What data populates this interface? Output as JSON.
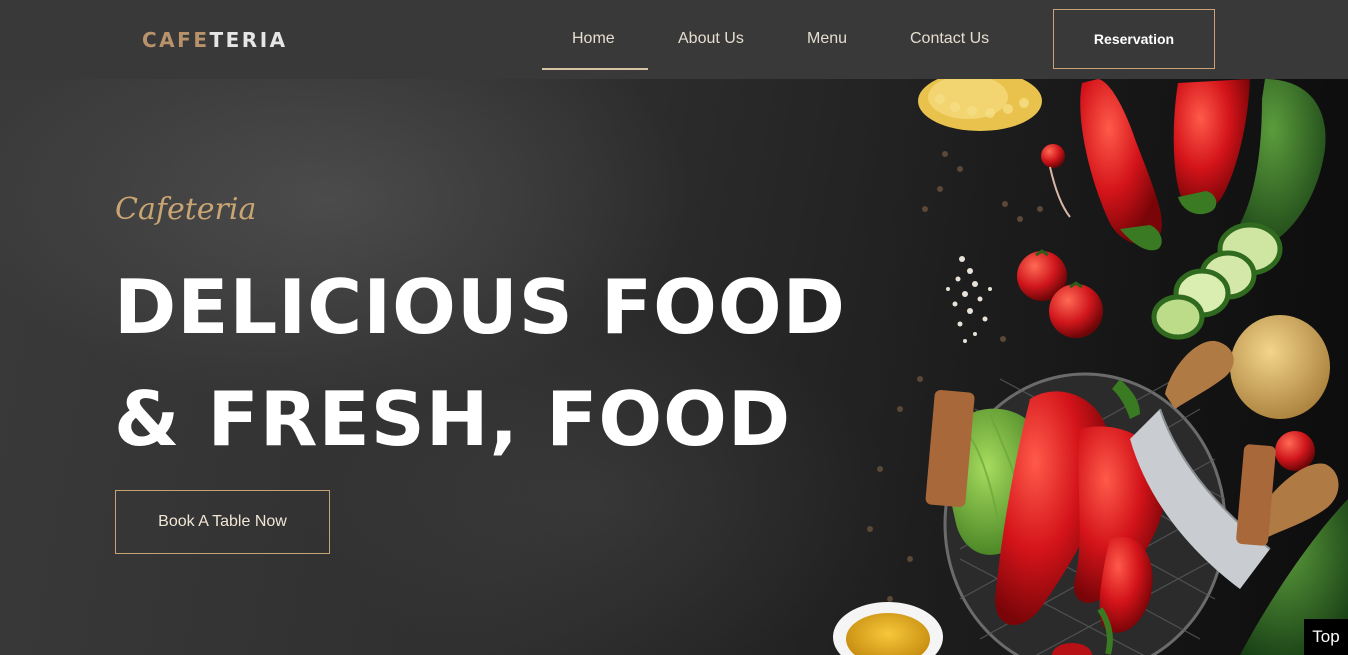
{
  "navbar": {
    "logo_part1": "CAFE",
    "logo_part2": "TERIA",
    "items": [
      {
        "label": "Home",
        "active": true
      },
      {
        "label": "About Us"
      },
      {
        "label": "Menu"
      },
      {
        "label": "Contact Us"
      }
    ],
    "reservation_label": "Reservation"
  },
  "hero": {
    "script_label": "Cafeteria",
    "headline_line1": "DELICIOUS FOOD",
    "headline_line2": "& FRESH, FOOD",
    "cta_label": "Book A Table Now"
  },
  "scroll_top_label": "Top",
  "colors": {
    "navbar_bg": "#393939",
    "accent_gold": "#c9a274",
    "hero_bg": "#2a2a2a",
    "text_light": "#ffffff"
  },
  "images": {
    "hero_food": "vegetables-flatlay-image"
  }
}
